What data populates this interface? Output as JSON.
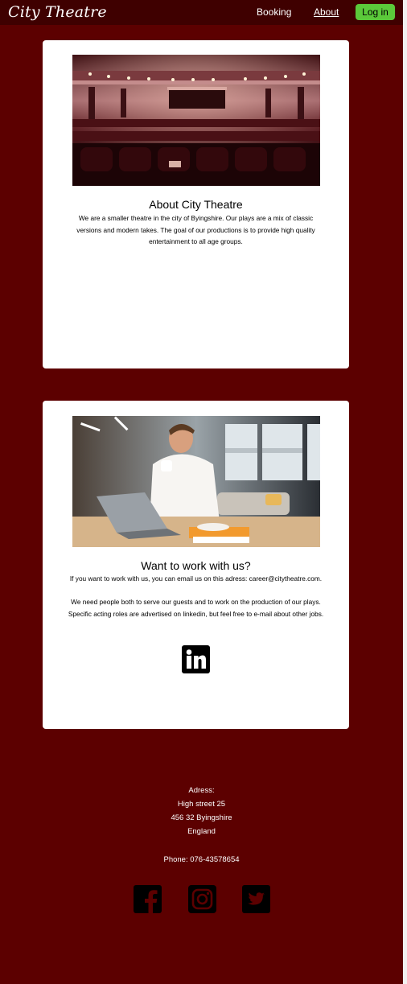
{
  "header": {
    "logo": "City Theatre",
    "nav": {
      "booking": "Booking",
      "about": "About"
    },
    "login_label": "Log in"
  },
  "about_card": {
    "image": "theatre-auditorium-photo",
    "title": "About City Theatre",
    "text": "We are a smaller theatre in the city of Byingshire. Our plays are a mix of classic versions and modern takes. The goal of our productions is to provide high quality entertainment to all age groups."
  },
  "work_card": {
    "image": "man-with-coffee-and-laptop-photo",
    "title": "Want to work with us?",
    "paragraph1": "If you want to work with us, you can email us on this adress: career@citytheatre.com.",
    "paragraph2": "We need people both to serve our guests and to work on the production of our plays. Specific acting roles are advertised on linkedin, but feel free to e-mail about other jobs.",
    "social_icon": "linkedin-icon"
  },
  "footer": {
    "address_label": "Adress:",
    "street": "High  street 25",
    "city": "456 32 Byingshire",
    "country": "England",
    "phone": "Phone: 076-43578654",
    "social_icons": [
      "facebook-icon",
      "instagram-icon",
      "twitter-icon"
    ]
  },
  "colors": {
    "page_background": "#5c0000",
    "header_background": "#3f0000",
    "login_button": "#5bc93a",
    "card_background": "#ffffff"
  }
}
